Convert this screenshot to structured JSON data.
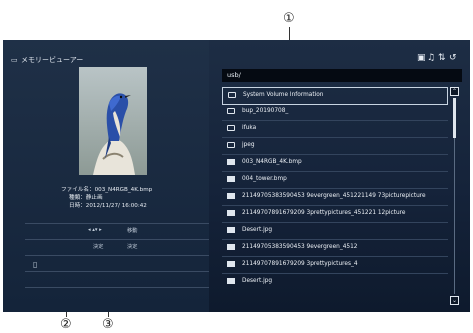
{
  "callouts": [
    "①",
    "②",
    "③"
  ],
  "header": {
    "title": "メモリービューアー",
    "icon": "memory-card-icon"
  },
  "file_info": {
    "filename_label": "ファイル名：",
    "filename": "003_N4RGB_4K.bmp",
    "type_label": "種類：",
    "type": "静止画",
    "date_label": "日時：",
    "date": "2012/11/27/ 16:00:42"
  },
  "controls": {
    "move_key": "◂ ▴▾ ▸",
    "move_label": "移動",
    "enter_label_1": "決定",
    "enter_label_2": "決定"
  },
  "path": "usb/",
  "toolbar_icons": [
    "photo-icon",
    "music-icon",
    "sort-icon",
    "return-icon"
  ],
  "files": [
    {
      "name": "System Volume Information",
      "kind": "folder"
    },
    {
      "name": "bup_20190708_",
      "kind": "folder"
    },
    {
      "name": "ifuka",
      "kind": "folder"
    },
    {
      "name": "jpeg",
      "kind": "folder"
    },
    {
      "name": "003_N4RGB_4K.bmp",
      "kind": "image"
    },
    {
      "name": "004_tower.bmp",
      "kind": "image"
    },
    {
      "name": "21149705383590453 9evergreen_451221149 73picturepicture",
      "kind": "image"
    },
    {
      "name": "21149707891679209 3prettypictures_451221 12picture",
      "kind": "image"
    },
    {
      "name": "Desert.jpg",
      "kind": "image"
    },
    {
      "name": "21149705383590453 9evergreen_4512",
      "kind": "image"
    },
    {
      "name": "21149707891679209 3prettypictures_4",
      "kind": "image"
    },
    {
      "name": "Desert.jpg",
      "kind": "image"
    }
  ],
  "colors": {
    "background": "#15233a",
    "text": "#eef2f7",
    "selection_border": "#c8d4e2"
  }
}
